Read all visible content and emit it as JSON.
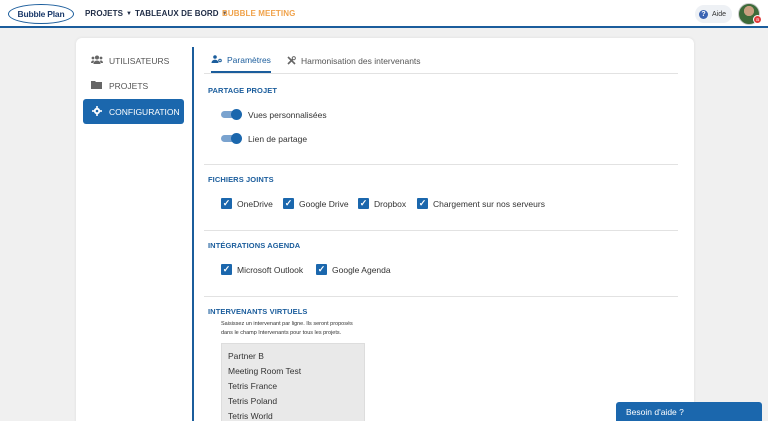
{
  "header": {
    "logo_text": "Bubble Plan",
    "nav": [
      {
        "label": "PROJETS",
        "caret": "▼"
      },
      {
        "label": "TABLEAUX DE BORD",
        "caret": "▼"
      },
      {
        "label": "BUBBLE MEETING"
      }
    ],
    "help_label": "Aide",
    "help_icon": "?",
    "avatar_badge": "a"
  },
  "sidebar": {
    "items": [
      {
        "label": "UTILISATEURS",
        "icon": "users-icon"
      },
      {
        "label": "PROJETS",
        "icon": "folder-icon"
      },
      {
        "label": "CONFIGURATION",
        "icon": "gear-icon",
        "active": true
      }
    ]
  },
  "tabs": [
    {
      "label": "Paramètres",
      "icon": "users-cog-icon",
      "active": true
    },
    {
      "label": "Harmonisation des intervenants",
      "icon": "tools-icon"
    }
  ],
  "sections": {
    "partage": {
      "title": "PARTAGE PROJET",
      "toggles": [
        {
          "label": "Vues personnalisées",
          "on": true
        },
        {
          "label": "Lien de partage",
          "on": true
        }
      ]
    },
    "fichiers": {
      "title": "FICHIERS JOINTS",
      "options": [
        {
          "label": "OneDrive",
          "checked": true
        },
        {
          "label": "Google Drive",
          "checked": true
        },
        {
          "label": "Dropbox",
          "checked": true
        },
        {
          "label": "Chargement sur nos serveurs",
          "checked": true
        }
      ]
    },
    "agenda": {
      "title": "INTÉGRATIONS AGENDA",
      "options": [
        {
          "label": "Microsoft Outlook",
          "checked": true
        },
        {
          "label": "Google Agenda",
          "checked": true
        }
      ]
    },
    "intervenants": {
      "title": "INTERVENANTS VIRTUELS",
      "hint_line1": "Saisissez un intervenant par ligne. Ils seront proposés",
      "hint_line2": "dans le champ Intervenants pour tous les projets.",
      "lines": [
        "Partner B",
        "Meeting Room Test",
        "Tetris France",
        "Tetris Poland",
        "Tetris World"
      ]
    }
  },
  "help_widget": {
    "label": "Besoin d'aide ?"
  },
  "colors": {
    "primary": "#1b67ad",
    "accent": "#f0a24a",
    "nav_text": "#1e2b45"
  }
}
